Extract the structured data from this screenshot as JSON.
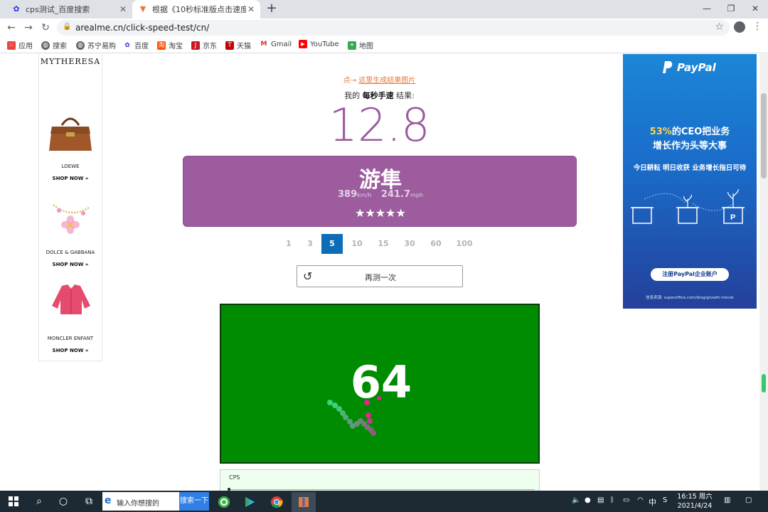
{
  "browser": {
    "tabs": [
      {
        "title": "cps测试_百度搜索",
        "close": "✕",
        "active": false
      },
      {
        "title": "根据《10秒标准版点击速度》测试",
        "close": "✕",
        "active": true
      }
    ],
    "new_tab": "+",
    "window_controls": {
      "minimize": "—",
      "restore": "❐",
      "close": "✕"
    },
    "url": "arealme.cn/click-speed-test/cn/",
    "bookmarks": [
      {
        "label": "应用",
        "icon": "apps-grid-icon",
        "color": "#e8453c"
      },
      {
        "label": "搜索",
        "icon": "globe-icon",
        "color": "#5f6368"
      },
      {
        "label": "苏宁易购",
        "icon": "globe-icon",
        "color": "#5f6368"
      },
      {
        "label": "百度",
        "icon": "baidu-paw-icon",
        "color": "#2932e1"
      },
      {
        "label": "淘宝",
        "icon": "taobao-icon",
        "color": "#ff5000"
      },
      {
        "label": "京东",
        "icon": "jd-icon",
        "color": "#c91623"
      },
      {
        "label": "天猫",
        "icon": "tmall-icon",
        "color": "#c40000"
      },
      {
        "label": "Gmail",
        "icon": "gmail-icon",
        "color": "#d93025"
      },
      {
        "label": "YouTube",
        "icon": "youtube-icon",
        "color": "#ff0000"
      },
      {
        "label": "地图",
        "icon": "maps-icon",
        "color": "#34a853"
      }
    ]
  },
  "left_ad": {
    "brand": "MYTHERESA",
    "items": [
      {
        "name": "LOEWE",
        "cta": "SHOP NOW »"
      },
      {
        "name": "DOLCE & GABBANA",
        "cta": "SHOP NOW »"
      },
      {
        "name": "MONCLER ENFANT",
        "cta": "SHOP NOW »"
      }
    ]
  },
  "result": {
    "link_prefix": "点→",
    "link_text": "这里生成结果图片",
    "label_prefix": "我的",
    "label_bold": "每秒手速",
    "label_suffix": "结果:",
    "score": "12.8",
    "rank": "游隼",
    "speed_kmh": "389",
    "kmh_unit": "km/h",
    "speed_mph": "241.7",
    "mph_unit": "mph",
    "stars": "★★★★★",
    "rating_stars": 5
  },
  "time_options": [
    "1",
    "3",
    "5",
    "10",
    "15",
    "30",
    "60",
    "100"
  ],
  "time_selected": "5",
  "retry_label": "再测一次",
  "click_area": {
    "count": "64",
    "color": "#008c00"
  },
  "cps_chart": {
    "label": "CPS"
  },
  "right_ad": {
    "logo": "PayPal",
    "headline_highlight": "53%",
    "headline_1": "的CEO把业务",
    "headline_2": "增长作为头等大事",
    "subline": "今日耕耘 明日收获 业务增长指日可待",
    "button": "注册PayPal企业账户",
    "source": "信息来源: superoffice.com/blog/growth-trends"
  },
  "taskbar": {
    "search_placeholder": "输入你想搜的",
    "search_button": "搜索一下",
    "ime": "中",
    "time": "16:15 周六",
    "date": "2021/4/24"
  }
}
